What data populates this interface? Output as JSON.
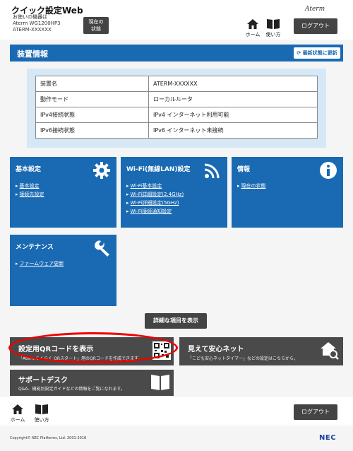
{
  "header": {
    "app_title": "クイック設定Web",
    "device_caption": "お使いの機器は",
    "device_model": "Aterm WG1200HP3",
    "device_name": "ATERM-XXXXXX",
    "status_button": "現在の\n状態",
    "brand": "Aterm",
    "home_label": "ホーム",
    "help_label": "使い方",
    "logout_label": "ログアウト"
  },
  "section": {
    "title": "装置情報",
    "refresh_label": "最新状態に更新"
  },
  "info_table": [
    {
      "key": "装置名",
      "value": "ATERM-XXXXXX"
    },
    {
      "key": "動作モード",
      "value": "ローカルルータ"
    },
    {
      "key": "IPv4接続状態",
      "value": "IPv4 インターネット利用可能"
    },
    {
      "key": "IPv6接続状態",
      "value": "IPv6 インターネット未接続"
    }
  ],
  "tiles": {
    "basic": {
      "title": "基本設定",
      "links": [
        "基本設定",
        "接続先設定"
      ]
    },
    "wifi": {
      "title": "Wi-Fi(無線LAN)設定",
      "links": [
        "Wi-Fi基本設定",
        "Wi-Fi詳細設定(2.4GHz)",
        "Wi-Fi詳細設定(5GHz)",
        "Wi-Fi接続通知設定"
      ]
    },
    "info": {
      "title": "情報",
      "links": [
        "現在の状態"
      ]
    },
    "maintenance": {
      "title": "メンテナンス",
      "links": [
        "ファームウェア更新"
      ]
    }
  },
  "detail_button": "詳細な項目を表示",
  "cards": {
    "qr": {
      "title": "設定用QRコードを表示",
      "desc": "「Atermらくらく QRスタート」用のQRコードを作成できます。"
    },
    "mieru": {
      "title": "見えて安心ネット",
      "desc": "「こども安心ネットタイマー」などの設定はこちらから。"
    },
    "support": {
      "title": "サポートデスク",
      "desc": "Q&A、機能別設定ガイドなどの情報をご覧になれます。"
    }
  },
  "footer": {
    "home_label": "ホーム",
    "help_label": "使い方",
    "logout_label": "ログアウト",
    "copyright": "Copyright© NEC Platforms, Ltd. 2001-2018",
    "nec": "NEC"
  },
  "colors": {
    "primary": "#1a6ab3",
    "dark_button": "#444444",
    "panel": "#d6e8f6",
    "highlight": "#e00000"
  }
}
